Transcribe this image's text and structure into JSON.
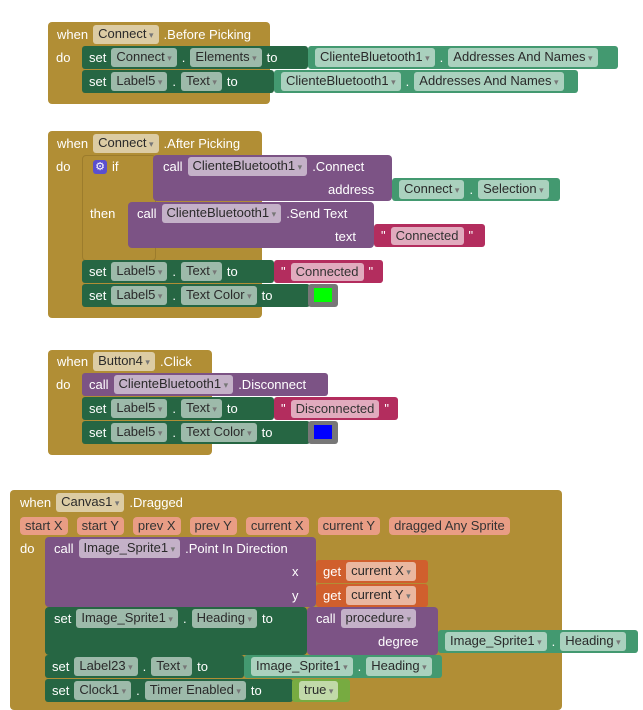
{
  "colors": {
    "event": "#B18E35",
    "setter": "#266643",
    "getter": "#439970",
    "procedure": "#7C5385",
    "text": "#B32D5E",
    "local_var": "#D05F2D",
    "logic": "#77AB41",
    "green_swatch": "#00FF00",
    "blue_swatch": "#0000FF"
  },
  "kw": {
    "when": "when",
    "do": "do",
    "set": "set",
    "to": "to",
    "call": "call",
    "dot": ".",
    "if": "if",
    "then": "then",
    "get": "get",
    "quote": "\""
  },
  "b1": {
    "component": "Connect",
    "event": ".Before Picking",
    "r1": {
      "component": "Connect",
      "property": "Elements",
      "g_component": "ClienteBluetooth1",
      "g_property": "Addresses And Names"
    },
    "r2": {
      "component": "Label5",
      "property": "Text",
      "g_component": "ClienteBluetooth1",
      "g_property": "Addresses And Names"
    }
  },
  "b2": {
    "component": "Connect",
    "event": ".After Picking",
    "if_call": {
      "component": "ClienteBluetooth1",
      "method": ".Connect",
      "arg": "address",
      "g_component": "Connect",
      "g_property": "Selection"
    },
    "then_call": {
      "component": "ClienteBluetooth1",
      "method": ".Send Text",
      "arg": "text",
      "value": "Connected"
    },
    "r1": {
      "component": "Label5",
      "property": "Text",
      "value": "Connected"
    },
    "r2": {
      "component": "Label5",
      "property": "Text Color",
      "swatch": "green"
    }
  },
  "b3": {
    "component": "Button4",
    "event": ".Click",
    "call": {
      "component": "ClienteBluetooth1",
      "method": ".Disconnect"
    },
    "r1": {
      "component": "Label5",
      "property": "Text",
      "value": "Disconnected"
    },
    "r2": {
      "component": "Label5",
      "property": "Text Color",
      "swatch": "blue"
    }
  },
  "b4": {
    "component": "Canvas1",
    "event": ".Dragged",
    "params": [
      "start X",
      "start Y",
      "prev X",
      "prev Y",
      "current X",
      "current Y",
      "dragged Any Sprite"
    ],
    "call": {
      "component": "Image_Sprite1",
      "method": ".Point In Direction",
      "x": "x",
      "y": "y",
      "x_var": "current X",
      "y_var": "current Y"
    },
    "r1": {
      "component": "Image_Sprite1",
      "property": "Heading",
      "procedure": "procedure",
      "arg": "degree",
      "g_component": "Image_Sprite1",
      "g_property": "Heading"
    },
    "r2": {
      "component": "Label23",
      "property": "Text",
      "g_component": "Image_Sprite1",
      "g_property": "Heading"
    },
    "r3": {
      "component": "Clock1",
      "property": "Timer Enabled",
      "value": "true"
    }
  }
}
